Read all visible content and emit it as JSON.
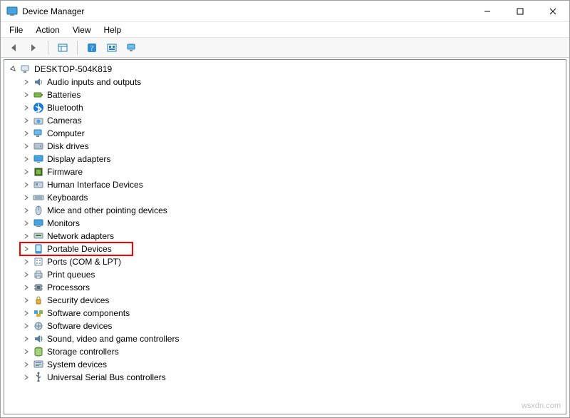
{
  "window": {
    "title": "Device Manager"
  },
  "menu": {
    "file": "File",
    "action": "Action",
    "view": "View",
    "help": "Help"
  },
  "tree": {
    "root": "DESKTOP-504K819",
    "items": [
      {
        "label": "Audio inputs and outputs",
        "icon": "audio-icon"
      },
      {
        "label": "Batteries",
        "icon": "battery-icon"
      },
      {
        "label": "Bluetooth",
        "icon": "bluetooth-icon"
      },
      {
        "label": "Cameras",
        "icon": "camera-icon"
      },
      {
        "label": "Computer",
        "icon": "computer-icon"
      },
      {
        "label": "Disk drives",
        "icon": "disk-icon"
      },
      {
        "label": "Display adapters",
        "icon": "display-icon"
      },
      {
        "label": "Firmware",
        "icon": "firmware-icon"
      },
      {
        "label": "Human Interface Devices",
        "icon": "hid-icon"
      },
      {
        "label": "Keyboards",
        "icon": "keyboard-icon"
      },
      {
        "label": "Mice and other pointing devices",
        "icon": "mouse-icon"
      },
      {
        "label": "Monitors",
        "icon": "monitor-icon"
      },
      {
        "label": "Network adapters",
        "icon": "network-icon"
      },
      {
        "label": "Portable Devices",
        "icon": "portable-icon",
        "highlight": true
      },
      {
        "label": "Ports (COM & LPT)",
        "icon": "port-icon"
      },
      {
        "label": "Print queues",
        "icon": "printer-icon"
      },
      {
        "label": "Processors",
        "icon": "cpu-icon"
      },
      {
        "label": "Security devices",
        "icon": "security-icon"
      },
      {
        "label": "Software components",
        "icon": "software-comp-icon"
      },
      {
        "label": "Software devices",
        "icon": "software-dev-icon"
      },
      {
        "label": "Sound, video and game controllers",
        "icon": "sound-icon"
      },
      {
        "label": "Storage controllers",
        "icon": "storage-icon"
      },
      {
        "label": "System devices",
        "icon": "system-icon"
      },
      {
        "label": "Universal Serial Bus controllers",
        "icon": "usb-icon"
      }
    ]
  },
  "watermark": "wsxdn.com"
}
